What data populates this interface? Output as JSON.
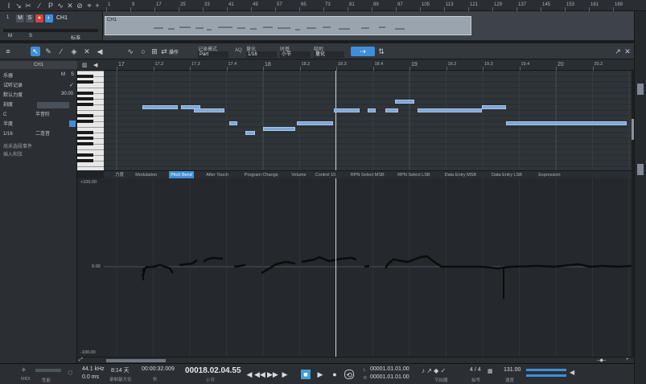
{
  "arrange": {
    "track_number": "1",
    "track_name": "CH1",
    "clip_name": "CH1",
    "btn_m": "M",
    "btn_s": "S",
    "btn_rec": "●",
    "btn_mon": "◐",
    "sub_m": "M",
    "sub_s": "S",
    "sub_label": "标准"
  },
  "top_ruler": [
    "1",
    "9",
    "17",
    "25",
    "33",
    "41",
    "49",
    "57",
    "65",
    "73",
    "81",
    "89",
    "97",
    "105",
    "113",
    "121",
    "129",
    "137",
    "145",
    "153",
    "161",
    "169"
  ],
  "editor_toolbar": {
    "action_label": "操作",
    "record_mode_label": "记录模式",
    "record_mode_value": "Part",
    "aq_label": "AQ",
    "quantize_label": "量化",
    "quantize_value": "1/16",
    "timebase_label": "时基",
    "timebase_value": "小节",
    "snap_label": "吸附",
    "snap_value": "量化"
  },
  "inspector": {
    "channel": "CH1",
    "instrument": "乐器",
    "btn_m": "M",
    "btn_s": "S",
    "trial_record": "试听记录",
    "default_velocity_label": "默认力度",
    "default_velocity_value": "30.00",
    "scale_label": "刻度",
    "key_value": "C",
    "scale_value": "半音阶",
    "chord_label": "半度",
    "grid_value": "1/16",
    "tone_value": "二连音",
    "no_event": "尚未选段事件",
    "insert_chord": "插入和弦"
  },
  "editor_ruler": [
    "17",
    "17.2",
    "17.3",
    "17.4",
    "18",
    "18.2",
    "18.3",
    "18.4",
    "19",
    "19.2",
    "19.3",
    "19.4",
    "20",
    "20.2"
  ],
  "lane_tabs": [
    "力度",
    "Modulation",
    "Pitch Bend",
    "After Touch",
    "Program Change",
    "Volume",
    "Control 10",
    "RPN Select MSB",
    "RPN Select LSB",
    "Data Entry MSB",
    "Data Entry LSB",
    "Expression"
  ],
  "lane_tab_active": "Pitch Bend",
  "cc_axis": {
    "top": "+100.00",
    "mid": "0.00",
    "bottom": "-100.00"
  },
  "transport": {
    "midi_label": "MIDI",
    "perf_label": "性能",
    "sample_rate": "44.1 kHz",
    "latency": "0.0 ms",
    "record_days": "8:14 天",
    "record_max_label": "录制最大化",
    "time_seconds": "00:00:32.009",
    "seconds_label": "秒",
    "position": "00018.02.04.55",
    "bar_label": "小节",
    "loop_l": "00001.01.01.00",
    "loop_r": "00001.01.01.00",
    "metronome_label": "节拍器",
    "signature": "4 / 4",
    "signature_label": "拍号",
    "tempo": "131.00",
    "tempo_label": "速度"
  }
}
